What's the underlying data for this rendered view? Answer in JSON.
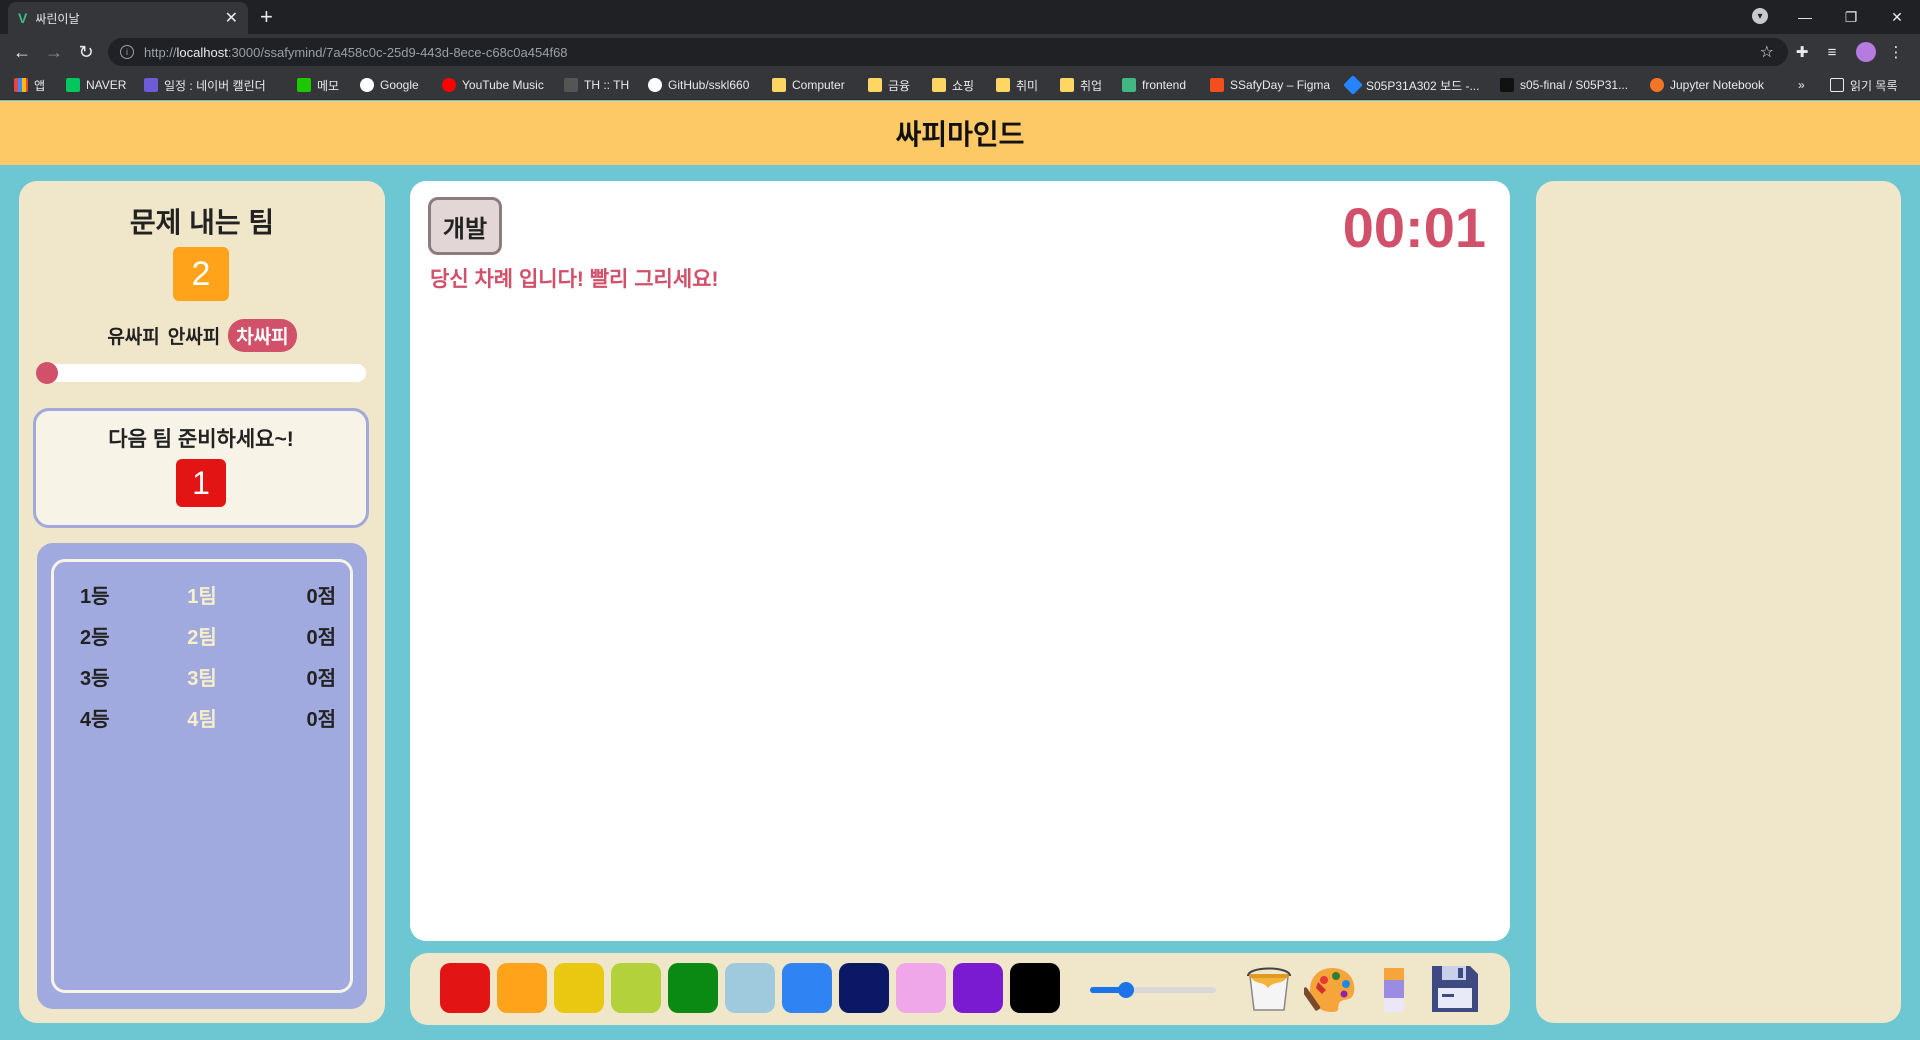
{
  "browser": {
    "tab_title": "싸린이날",
    "url_scheme": "http://",
    "url_host": "localhost",
    "url_path": ":3000/ssafymind/7a458c0c-25d9-443d-8ece-c68c0a454f68",
    "bookmarks": [
      {
        "label": "앱",
        "icon": "apps-grid-icon"
      },
      {
        "label": "NAVER",
        "icon": "naver-icon"
      },
      {
        "label": "일정 : 네이버 캘린더",
        "icon": "calendar-icon"
      },
      {
        "label": "메모",
        "icon": "memo-icon"
      },
      {
        "label": "Google",
        "icon": "google-icon"
      },
      {
        "label": "YouTube Music",
        "icon": "youtube-music-icon"
      },
      {
        "label": "TH :: TH",
        "icon": "th-icon"
      },
      {
        "label": "GitHub/sskl660",
        "icon": "github-icon"
      },
      {
        "label": "Computer",
        "icon": "folder-icon"
      },
      {
        "label": "금융",
        "icon": "folder-icon"
      },
      {
        "label": "쇼핑",
        "icon": "folder-icon"
      },
      {
        "label": "취미",
        "icon": "folder-icon"
      },
      {
        "label": "취업",
        "icon": "folder-icon"
      },
      {
        "label": "frontend",
        "icon": "vue-icon"
      },
      {
        "label": "SSafyDay – Figma",
        "icon": "figma-icon"
      },
      {
        "label": "S05P31A302 보드 -...",
        "icon": "jira-icon"
      },
      {
        "label": "s05-final / S05P31...",
        "icon": "gitlab-icon"
      },
      {
        "label": "Jupyter Notebook",
        "icon": "jupyter-icon"
      }
    ],
    "reading_list": "읽기 목록",
    "overflow": "»"
  },
  "app": {
    "title": "싸피마인드"
  },
  "left": {
    "title": "문제 내는 팀",
    "current_team": "2",
    "members": [
      "유싸피",
      "안싸피",
      "차싸피"
    ],
    "active_member": "차싸피",
    "progress": 0.0,
    "next_text": "다음 팀 준비하세요~!",
    "next_team": "1",
    "ranking": [
      {
        "rank": "1등",
        "team": "1팀",
        "score": "0점"
      },
      {
        "rank": "2등",
        "team": "2팀",
        "score": "0점"
      },
      {
        "rank": "3등",
        "team": "3팀",
        "score": "0점"
      },
      {
        "rank": "4등",
        "team": "4팀",
        "score": "0점"
      }
    ]
  },
  "canvas": {
    "word": "개발",
    "timer": "00:01",
    "message": "당신 차례 입니다! 빨리 그리세요!"
  },
  "palette": {
    "colors": [
      "#e31414",
      "#ffa31a",
      "#eac710",
      "#b3d13b",
      "#0a8a12",
      "#9fc9dc",
      "#3083f2",
      "#0c1866",
      "#f0a7ea",
      "#7a1ad1",
      "#000000"
    ],
    "brush_size": 0.25,
    "tools": [
      "paint-bucket-icon",
      "palette-icon",
      "eraser-icon",
      "save-icon"
    ]
  }
}
